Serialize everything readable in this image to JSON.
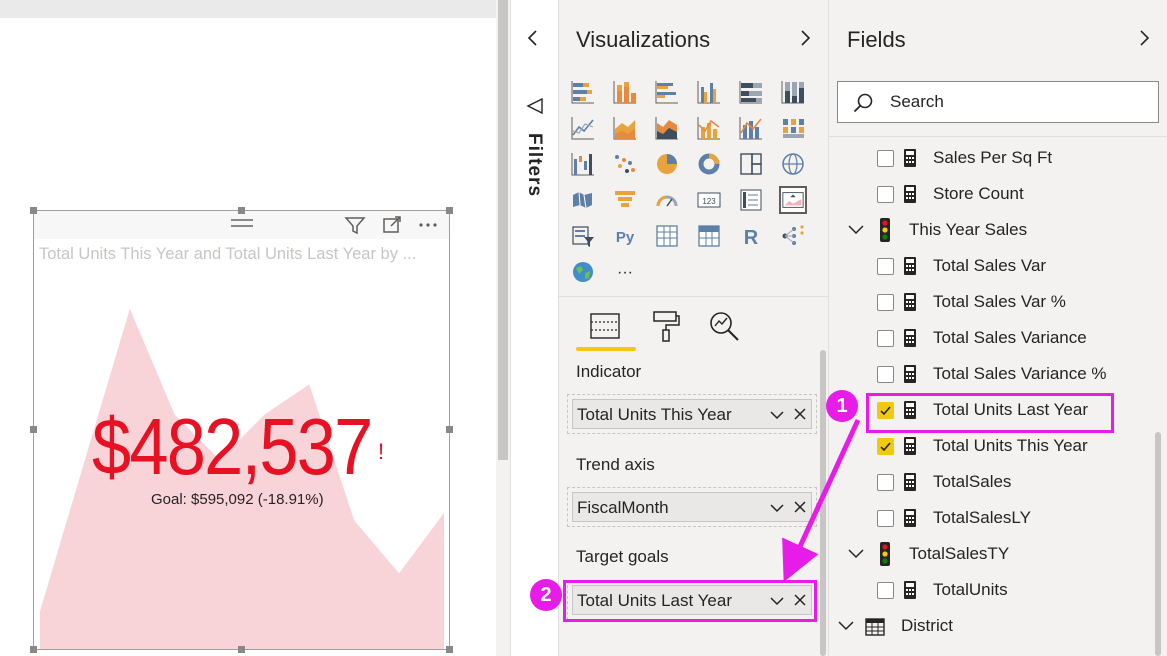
{
  "visual": {
    "title": "Total Units This Year and Total Units Last Year by ...",
    "kpi_value": "$482,537",
    "kpi_alert": "!",
    "goal_text": "Goal: $595,092 (-18.91%)",
    "indicator_color": "#e81123",
    "trend_fill_color": "#f8d3d7",
    "trend": [
      0.1,
      0.5,
      0.9,
      0.62,
      0.5,
      0.62,
      0.7,
      0.34,
      0.2,
      0.36
    ]
  },
  "filters_pane": {
    "label": "Filters"
  },
  "visualizations": {
    "title": "Visualizations",
    "icons": [
      "stacked-bar-chart-icon",
      "stacked-column-chart-icon",
      "clustered-bar-chart-icon",
      "clustered-column-chart-icon",
      "100-stacked-bar-chart-icon",
      "100-stacked-column-chart-icon",
      "line-chart-icon",
      "area-chart-icon",
      "stacked-area-chart-icon",
      "line-and-column-chart-icon",
      "line-and-stacked-column-chart-icon",
      "ribbon-chart-icon",
      "waterfall-chart-icon",
      "scatter-chart-icon",
      "pie-chart-icon",
      "donut-chart-icon",
      "treemap-icon",
      "map-icon",
      "filled-map-icon",
      "funnel-icon",
      "gauge-icon",
      "card-icon",
      "multi-row-card-icon",
      "kpi-icon",
      "slicer-icon",
      "python-visual-icon",
      "table-icon",
      "matrix-icon",
      "r-visual-icon",
      "decomposition-tree-icon",
      "arcgis-map-icon",
      "more-visuals-icon"
    ],
    "python_label": "Py",
    "r_label": "R",
    "card_label": "123",
    "more_label": "···",
    "wells": [
      {
        "label": "Indicator",
        "value": "Total Units This Year"
      },
      {
        "label": "Trend axis",
        "value": "FiscalMonth"
      },
      {
        "label": "Target goals",
        "value": "Total Units Last Year"
      }
    ]
  },
  "fields": {
    "title": "Fields",
    "search_placeholder": "Search",
    "rows": [
      {
        "type": "measure",
        "label": "Sales Per Sq Ft",
        "checked": false
      },
      {
        "type": "measure",
        "label": "Store Count",
        "checked": false
      },
      {
        "type": "kpi-group",
        "label": "This Year Sales"
      },
      {
        "type": "measure",
        "label": "Total Sales Var",
        "checked": false
      },
      {
        "type": "measure",
        "label": "Total Sales Var %",
        "checked": false
      },
      {
        "type": "measure",
        "label": "Total Sales Variance",
        "checked": false
      },
      {
        "type": "measure",
        "label": "Total Sales Variance %",
        "checked": false
      },
      {
        "type": "measure",
        "label": "Total Units Last Year",
        "checked": true
      },
      {
        "type": "measure",
        "label": "Total Units This Year",
        "checked": true
      },
      {
        "type": "measure",
        "label": "TotalSales",
        "checked": false
      },
      {
        "type": "measure",
        "label": "TotalSalesLY",
        "checked": false
      },
      {
        "type": "kpi-group",
        "label": "TotalSalesTY"
      },
      {
        "type": "measure",
        "label": "TotalUnits",
        "checked": false
      },
      {
        "type": "table",
        "label": "District"
      }
    ]
  },
  "annotations": {
    "step1": "1",
    "step2": "2",
    "color": "#e81ce8"
  }
}
